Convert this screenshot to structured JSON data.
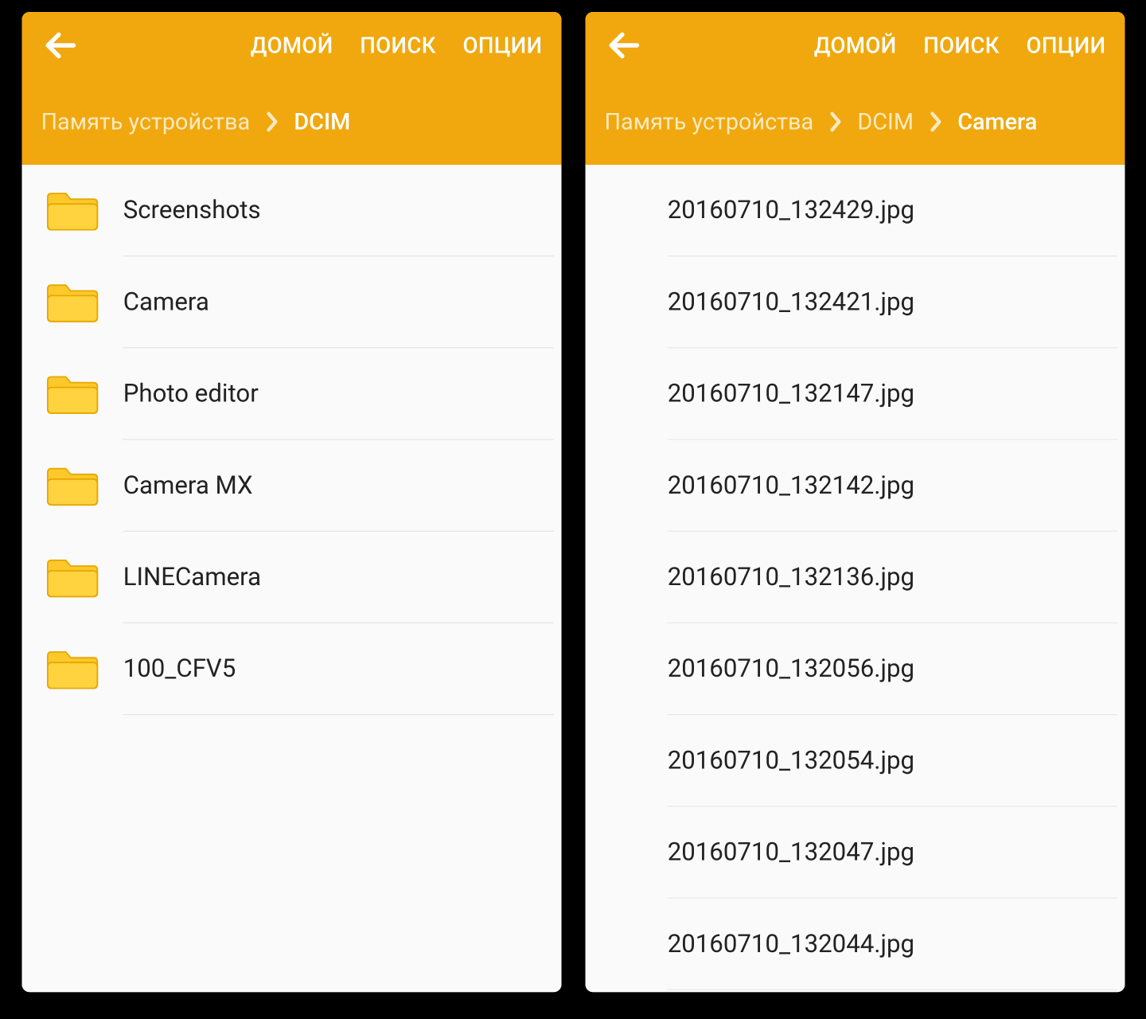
{
  "colors": {
    "accent": "#f0a80e"
  },
  "icons": {
    "back": "arrow-left",
    "folder": "folder"
  },
  "left": {
    "nav": {
      "home": "ДОМОЙ",
      "search": "ПОИСК",
      "options": "ОПЦИИ"
    },
    "breadcrumb": [
      {
        "label": "Память устройства",
        "active": false
      },
      {
        "label": "DCIM",
        "active": true
      }
    ],
    "items": [
      {
        "name": "Screenshots"
      },
      {
        "name": "Camera"
      },
      {
        "name": "Photo editor"
      },
      {
        "name": "Camera MX"
      },
      {
        "name": "LINECamera"
      },
      {
        "name": "100_CFV5"
      }
    ]
  },
  "right": {
    "nav": {
      "home": "ДОМОЙ",
      "search": "ПОИСК",
      "options": "ОПЦИИ"
    },
    "breadcrumb": [
      {
        "label": "Память устройства",
        "active": false
      },
      {
        "label": "DCIM",
        "active": false
      },
      {
        "label": "Camera",
        "active": true
      }
    ],
    "items": [
      {
        "name": "20160710_132429.jpg"
      },
      {
        "name": "20160710_132421.jpg"
      },
      {
        "name": "20160710_132147.jpg"
      },
      {
        "name": "20160710_132142.jpg"
      },
      {
        "name": "20160710_132136.jpg"
      },
      {
        "name": "20160710_132056.jpg"
      },
      {
        "name": "20160710_132054.jpg"
      },
      {
        "name": "20160710_132047.jpg"
      },
      {
        "name": "20160710_132044.jpg"
      }
    ]
  }
}
